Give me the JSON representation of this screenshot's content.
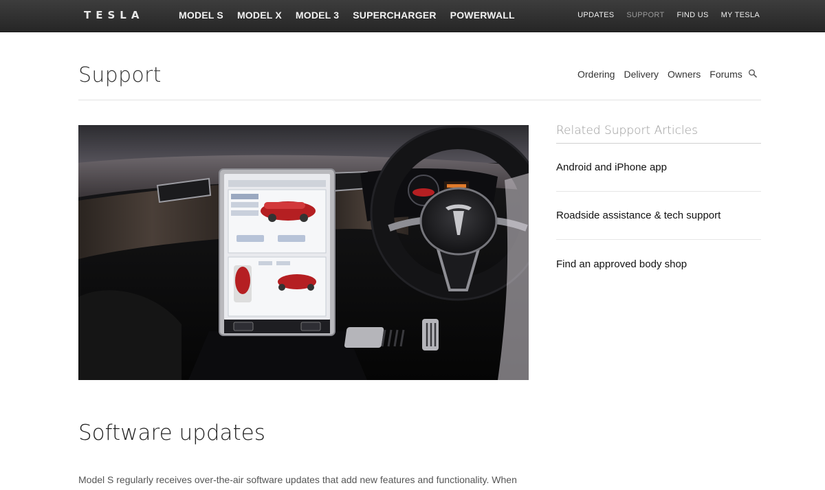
{
  "brand": {
    "logo_letters": [
      "T",
      "E",
      "S",
      "L",
      "A"
    ]
  },
  "topnav": {
    "main_links": [
      "MODEL S",
      "MODEL X",
      "MODEL 3",
      "SUPERCHARGER",
      "POWERWALL"
    ],
    "util_links": [
      "UPDATES",
      "SUPPORT",
      "FIND US",
      "MY TESLA"
    ],
    "active_util": "SUPPORT"
  },
  "page": {
    "title": "Support",
    "subnav": [
      "Ordering",
      "Delivery",
      "Owners",
      "Forums"
    ],
    "search_icon": "search-icon"
  },
  "hero": {
    "image": "car-interior-dashboard-touchscreen-steering-wheel"
  },
  "related": {
    "title": "Related Support Articles",
    "items": [
      "Android and iPhone app",
      "Roadside assistance & tech support",
      "Find an approved body shop"
    ]
  },
  "section": {
    "heading": "Software updates",
    "body": "Model S regularly receives over-the-air software updates that add new features and functionality. When"
  },
  "colors": {
    "nav_bg": "#2f2f2f",
    "nav_text": "#f2f2f2",
    "nav_active": "#9a9a9a",
    "accent_red": "#c8202a"
  }
}
